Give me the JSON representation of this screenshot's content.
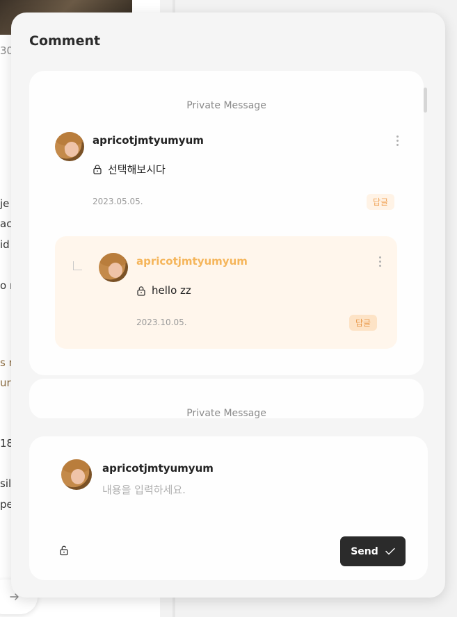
{
  "background": {
    "fragments": [
      "30",
      "je",
      "aci",
      "id",
      "o re",
      "s n",
      "ur",
      "18",
      "sil",
      "pe"
    ]
  },
  "panel": {
    "title": "Comment"
  },
  "thread": {
    "private_label": "Private Message",
    "comment": {
      "username": "apricotjmtyumyum",
      "text": "선택해보시다",
      "date": "2023.05.05.",
      "reply_label": "답글"
    },
    "reply": {
      "username": "apricotjmtyumyum",
      "text": "hello zz",
      "date": "2023.10.05.",
      "reply_label": "답글"
    },
    "next_private_label": "Private Message"
  },
  "composer": {
    "username": "apricotjmtyumyum",
    "placeholder": "내용을 입력하세요.",
    "value": "",
    "send_label": "Send"
  },
  "colors": {
    "accent_orange": "#f5b55a",
    "reply_bg": "#fff6ec",
    "send_button": "#2b2b2b"
  },
  "icons": {
    "lock": "lock-icon",
    "unlock": "unlock-icon",
    "more": "kebab-menu-icon",
    "send_check": "check-icon",
    "arrow": "arrow-right-icon",
    "reply": "reply-arrow-icon"
  }
}
